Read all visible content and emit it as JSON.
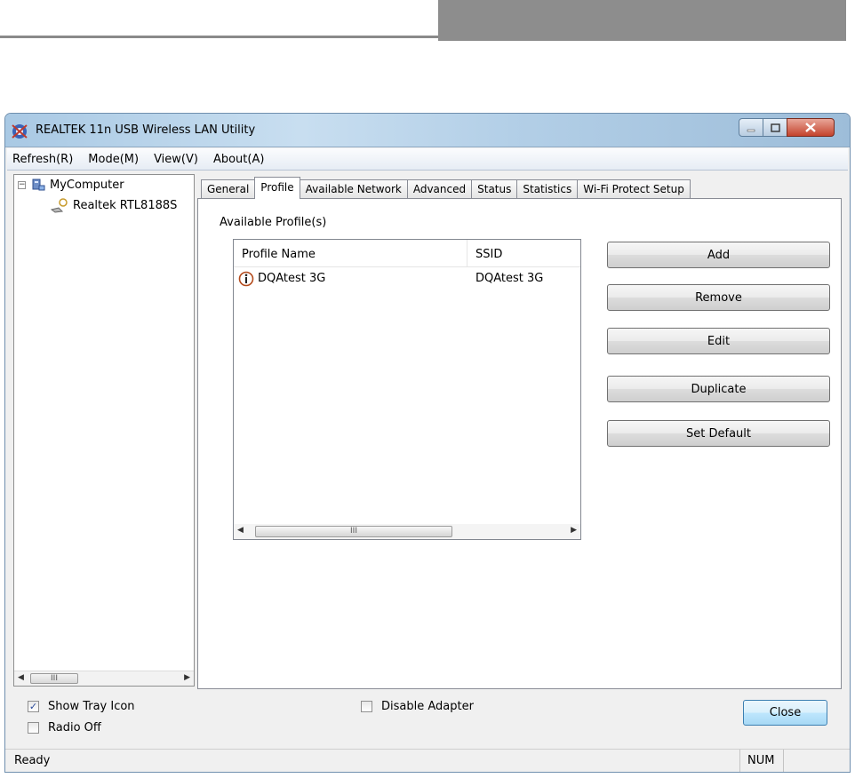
{
  "window": {
    "title": "REALTEK 11n USB Wireless LAN Utility"
  },
  "menu": {
    "items": [
      "Refresh(R)",
      "Mode(M)",
      "View(V)",
      "About(A)"
    ]
  },
  "tree": {
    "root": "MyComputer",
    "child": "Realtek RTL8188S",
    "scroll_thumb": "III"
  },
  "tabs": [
    "General",
    "Profile",
    "Available Network",
    "Advanced",
    "Status",
    "Statistics",
    "Wi-Fi Protect Setup"
  ],
  "active_tab": "Profile",
  "profile": {
    "section_label": "Available Profile(s)",
    "columns": [
      "Profile Name",
      "SSID"
    ],
    "rows": [
      {
        "name": "DQAtest 3G",
        "ssid": "DQAtest 3G"
      }
    ],
    "scroll_thumb": "III"
  },
  "buttons": {
    "add": "Add",
    "remove": "Remove",
    "edit": "Edit",
    "duplicate": "Duplicate",
    "set_default": "Set Default",
    "close": "Close"
  },
  "options": {
    "show_tray_icon": {
      "label": "Show Tray Icon",
      "checked": true
    },
    "radio_off": {
      "label": "Radio Off",
      "checked": false
    },
    "disable_adapter": {
      "label": "Disable Adapter",
      "checked": false
    }
  },
  "status": {
    "text": "Ready",
    "num": "NUM"
  }
}
